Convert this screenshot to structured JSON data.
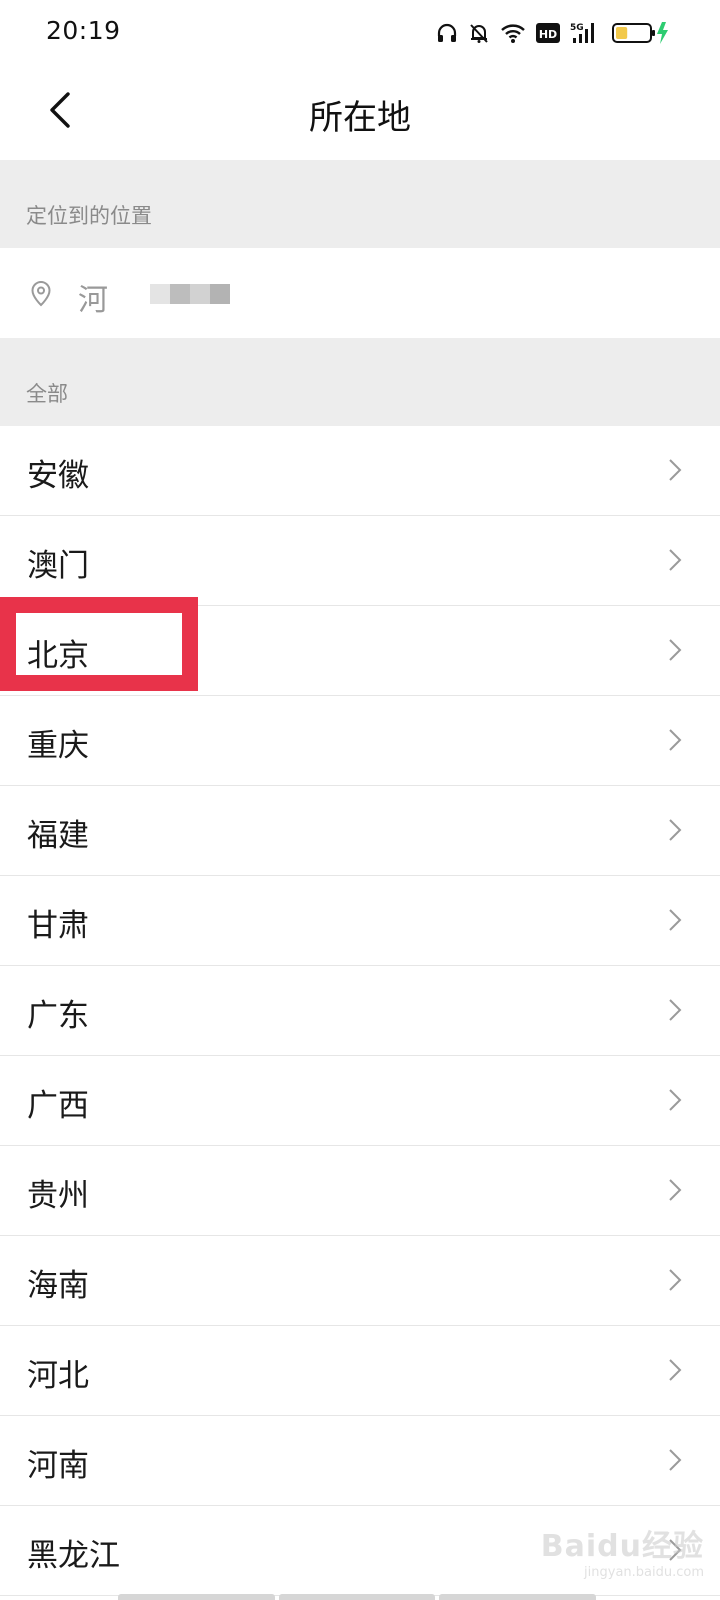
{
  "status_bar": {
    "time": "20:19",
    "icons": [
      "headphones-icon",
      "bell-off-icon",
      "wifi-icon",
      "hd-icon",
      "signal-5g-icon",
      "battery-charging-icon"
    ],
    "hd_label": "HD",
    "network_label": "5G",
    "battery_level": 0.35,
    "charging_color": "#2ecc71"
  },
  "nav": {
    "back_icon": "chevron-left-icon",
    "title": "所在地"
  },
  "located": {
    "header": "定位到的位置",
    "icon": "location-pin-icon",
    "value": "河"
  },
  "all_section": {
    "header": "全部"
  },
  "provinces": [
    {
      "name": "安徽"
    },
    {
      "name": "澳门"
    },
    {
      "name": "北京"
    },
    {
      "name": "重庆"
    },
    {
      "name": "福建"
    },
    {
      "name": "甘肃"
    },
    {
      "name": "广东"
    },
    {
      "name": "广西"
    },
    {
      "name": "贵州"
    },
    {
      "name": "海南"
    },
    {
      "name": "河北"
    },
    {
      "name": "河南"
    },
    {
      "name": "黑龙江"
    }
  ],
  "highlight": {
    "target": "北京",
    "color": "#e8334a"
  },
  "watermark": {
    "logo": "Baidu经验",
    "url": "jingyan.baidu.com"
  },
  "colors": {
    "section_bg": "#ededed",
    "divider": "#e6e6e6",
    "secondary_text": "#8a8a8a"
  }
}
